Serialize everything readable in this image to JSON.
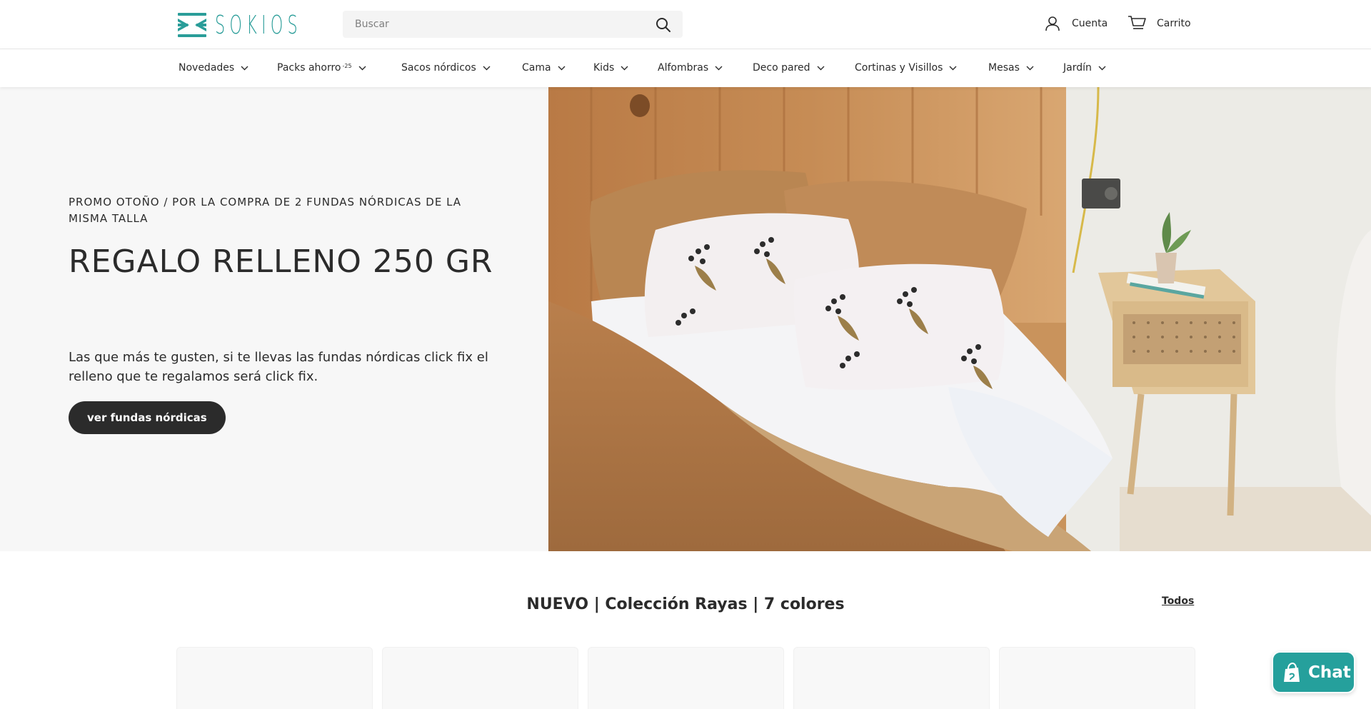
{
  "header": {
    "logo_text": "SOKIOS",
    "search_placeholder": "Buscar",
    "account_label": "Cuenta",
    "cart_label": "Carrito"
  },
  "nav": {
    "items": [
      {
        "label": "Novedades",
        "sup": ""
      },
      {
        "label": "Packs ahorro",
        "sup": "-25"
      },
      {
        "label": "Sacos nórdicos",
        "sup": ""
      },
      {
        "label": "Cama",
        "sup": ""
      },
      {
        "label": "Kids",
        "sup": ""
      },
      {
        "label": "Alfombras",
        "sup": ""
      },
      {
        "label": "Deco pared",
        "sup": ""
      },
      {
        "label": "Cortinas y Visillos",
        "sup": ""
      },
      {
        "label": "Mesas",
        "sup": ""
      },
      {
        "label": "Jardín",
        "sup": ""
      }
    ]
  },
  "hero": {
    "kicker": "PROMO OTOÑO / POR LA COMPRA DE 2 FUNDAS NÓRDICAS DE LA MISMA TALLA",
    "title": "REGALO RELLENO 250 GR",
    "description": "Las que más te gusten, si te llevas las fundas nórdicas click fix el relleno que te regalamos será click fix.",
    "button_label": "ver fundas nórdicas"
  },
  "section": {
    "title": "NUEVO | Colección Rayas | 7 colores",
    "link_label": "Todos"
  },
  "chat": {
    "label": "Chat"
  },
  "colors": {
    "brand": "#2a9d99",
    "text": "#2b2b2b",
    "chat": "#25a09c"
  }
}
